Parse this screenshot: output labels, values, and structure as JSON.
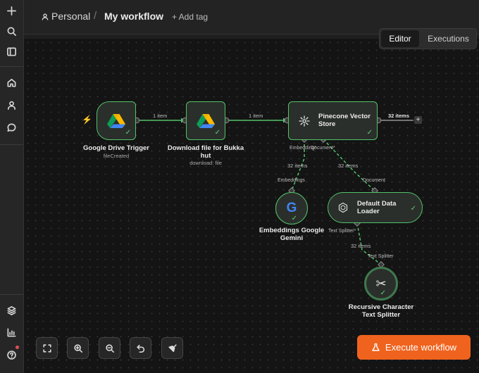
{
  "header": {
    "project": "Personal",
    "separator": "/",
    "workflow_title": "My workflow",
    "add_tag": "+ Add tag"
  },
  "view_toggle": {
    "editor": "Editor",
    "executions": "Executions"
  },
  "nodes": {
    "trigger": {
      "label": "Google Drive Trigger",
      "sub": "fileCreated"
    },
    "download": {
      "label": "Download file for Bukka hut",
      "sub": "download: file"
    },
    "pinecone": {
      "label": "Pinecone Vector Store",
      "port_embedding": "Embedding*",
      "port_document": "Document*"
    },
    "embeddings": {
      "label": "Embeddings Google Gemini",
      "port_top": "Embeddings"
    },
    "loader": {
      "label": "Default Data Loader",
      "port_top": "Document",
      "port_bottom": "Text Splitter*"
    },
    "splitter": {
      "label": "Recursive Character Text Splitter",
      "port_top": "Text Splitter"
    }
  },
  "edges": {
    "e1": "1 item",
    "e2": "1 item",
    "e3": "32 items",
    "e4": "32 items",
    "e5": "32 items",
    "e6": "32 items"
  },
  "execute_button": "Execute workflow",
  "colors": {
    "accent": "#f0631e",
    "success": "#52c26a",
    "canvas": "#141414"
  }
}
